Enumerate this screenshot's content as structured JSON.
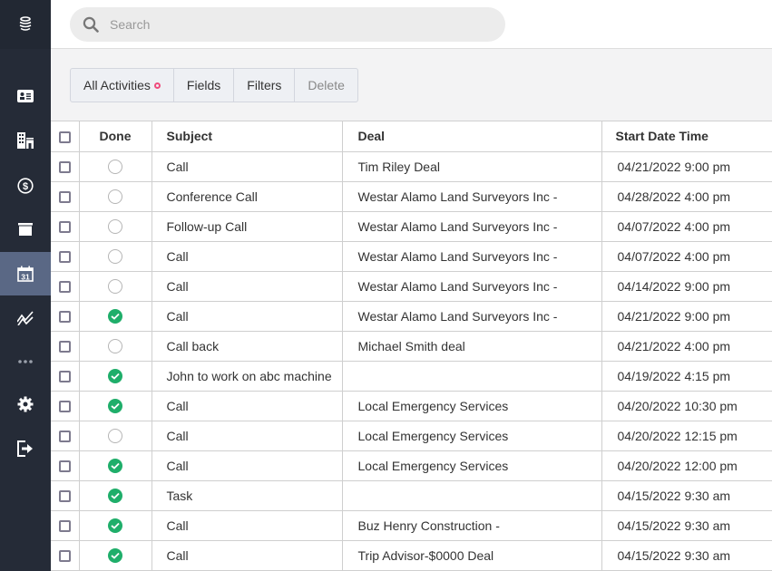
{
  "sidebar": {
    "logo_icon": "stacked-layers-logo",
    "items": [
      {
        "name": "contacts",
        "icon": "contact-card-icon",
        "active": false
      },
      {
        "name": "companies",
        "icon": "buildings-icon",
        "active": false
      },
      {
        "name": "deals",
        "icon": "dollar-circle-icon",
        "active": false
      },
      {
        "name": "archive",
        "icon": "archive-box-icon",
        "active": false
      },
      {
        "name": "activities",
        "icon": "calendar-icon",
        "active": true,
        "calendar_day": "31"
      },
      {
        "name": "reports",
        "icon": "trend-chart-icon",
        "active": false
      },
      {
        "name": "more",
        "icon": "more-dots-icon",
        "active": false
      },
      {
        "name": "settings",
        "icon": "gear-icon",
        "active": false
      },
      {
        "name": "logout",
        "icon": "logout-icon",
        "active": false
      }
    ]
  },
  "search": {
    "placeholder": "Search",
    "value": ""
  },
  "toolbar": {
    "all_activities_label": "All Activities",
    "fields_label": "Fields",
    "filters_label": "Filters",
    "delete_label": "Delete",
    "indicator_color": "#ef4b7c"
  },
  "table": {
    "columns": {
      "done": "Done",
      "subject": "Subject",
      "deal": "Deal",
      "start": "Start Date Time"
    },
    "rows": [
      {
        "done": false,
        "subject": "Call",
        "deal": "Tim Riley Deal",
        "start": "04/21/2022 9:00 pm"
      },
      {
        "done": false,
        "subject": "Conference Call",
        "deal": "Westar Alamo Land Surveyors Inc -",
        "start": "04/28/2022 4:00 pm"
      },
      {
        "done": false,
        "subject": "Follow-up Call",
        "deal": "Westar Alamo Land Surveyors Inc -",
        "start": "04/07/2022 4:00 pm"
      },
      {
        "done": false,
        "subject": "Call",
        "deal": "Westar Alamo Land Surveyors Inc -",
        "start": "04/07/2022 4:00 pm"
      },
      {
        "done": false,
        "subject": "Call",
        "deal": "Westar Alamo Land Surveyors Inc -",
        "start": "04/14/2022 9:00 pm"
      },
      {
        "done": true,
        "subject": "Call",
        "deal": "Westar Alamo Land Surveyors Inc -",
        "start": "04/21/2022 9:00 pm"
      },
      {
        "done": false,
        "subject": "Call back",
        "deal": "Michael Smith deal",
        "start": "04/21/2022 4:00 pm"
      },
      {
        "done": true,
        "subject": "John to work on abc machine",
        "deal": "",
        "start": "04/19/2022 4:15 pm"
      },
      {
        "done": true,
        "subject": "Call",
        "deal": "Local Emergency Services",
        "start": "04/20/2022 10:30 pm"
      },
      {
        "done": false,
        "subject": "Call",
        "deal": "Local Emergency Services",
        "start": "04/20/2022 12:15 pm"
      },
      {
        "done": true,
        "subject": "Call",
        "deal": "Local Emergency Services",
        "start": "04/20/2022 12:00 pm"
      },
      {
        "done": true,
        "subject": "Task",
        "deal": "",
        "start": "04/15/2022 9:30 am"
      },
      {
        "done": true,
        "subject": "Call",
        "deal": "Buz Henry Construction -",
        "start": "04/15/2022 9:30 am"
      },
      {
        "done": true,
        "subject": "Call",
        "deal": "Trip Advisor-$0000 Deal",
        "start": "04/15/2022 9:30 am"
      }
    ]
  },
  "colors": {
    "sidebar_bg": "#252b37",
    "sidebar_active": "#5a6885",
    "done_green": "#1fae6a"
  }
}
